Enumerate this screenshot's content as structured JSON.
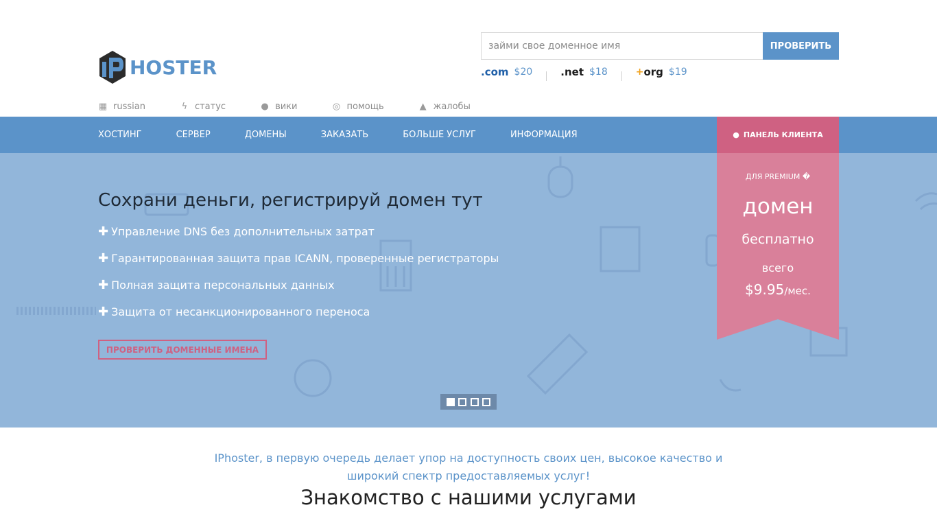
{
  "brand": {
    "logo_text": "HOSTER",
    "accent": "#5b93c9",
    "pink": "#cf6182"
  },
  "search": {
    "placeholder": "займи свое доменное имя",
    "button": "ПРОВЕРИТЬ"
  },
  "tlds": [
    {
      "name": ".com",
      "price": "$20"
    },
    {
      "name": ".net",
      "price": "$18"
    },
    {
      "name": "org",
      "price": "$19"
    }
  ],
  "util_nav": [
    {
      "label": "russian",
      "icon": "language-icon"
    },
    {
      "label": "статус",
      "icon": "lightning-icon"
    },
    {
      "label": "вики",
      "icon": "globe-icon"
    },
    {
      "label": "помощь",
      "icon": "lifebuoy-icon"
    },
    {
      "label": "жалобы",
      "icon": "warning-icon"
    }
  ],
  "main_nav": [
    "ХОСТИНГ",
    "СЕРВЕР",
    "ДОМЕНЫ",
    "ЗАКАЗАТЬ",
    "БОЛЬШЕ УСЛУГ",
    "ИНФОРМАЦИЯ"
  ],
  "client_panel": "ПАНЕЛЬ КЛИЕНТА",
  "hero": {
    "title": "Сохрани деньги, регистрируй домен тут",
    "features": [
      "Управление DNS без дополнительных затрат",
      "Гарантированная защита прав ICANN, проверенные регистраторы",
      "Полная защита персональных данных",
      "Защита от несанкционированного переноса"
    ],
    "button": "ПРОВЕРИТЬ ДОМЕННЫЕ ИМЕНА",
    "slides": 4,
    "active_slide": 1
  },
  "ribbon": {
    "small": "ДЛЯ PREMIUM �",
    "big": "домен",
    "mid": "бесплатно",
    "all": "всего",
    "price": "$9.95",
    "per": "/мес."
  },
  "intro": {
    "text": "IPhoster, в первую очередь делает упор на доступность своих цен, высокое качество и широкий спектр предоставляемых услуг!",
    "heading": "Знакомство с нашими услугами"
  }
}
